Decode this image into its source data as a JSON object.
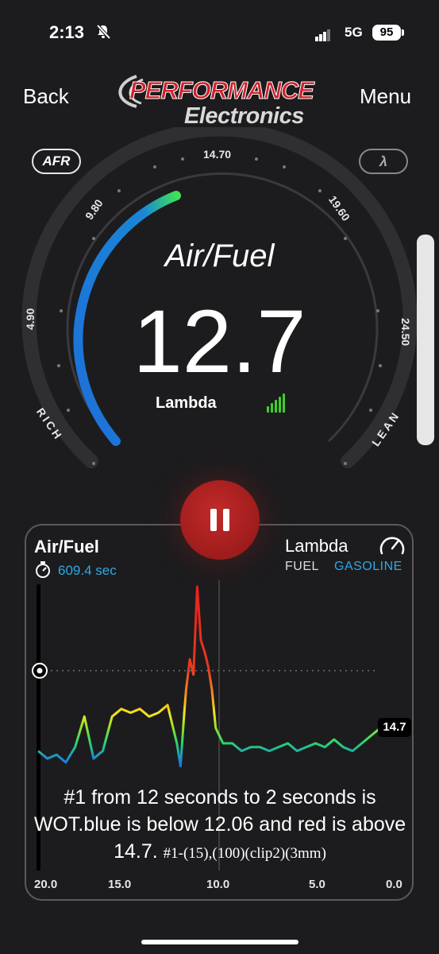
{
  "status": {
    "time": "2:13",
    "network": "5G",
    "battery": "95"
  },
  "header": {
    "back_label": "Back",
    "menu_label": "Menu",
    "logo_line1": "PERFORMANCE",
    "logo_line2": "Electronics"
  },
  "gauge": {
    "afr_toggle": "AFR",
    "lambda_toggle": "λ",
    "title": "Air/Fuel",
    "value": "12.7",
    "sublabel": "Lambda",
    "ticks": [
      "4.90",
      "9.80",
      "14.70",
      "19.60",
      "24.50"
    ],
    "rich_label": "RICH",
    "lean_label": "LEAN",
    "level_fraction": 0.36
  },
  "chart": {
    "title": "Air/Fuel",
    "elapsed": "609.4 sec",
    "lambda_label": "Lambda",
    "fuel_label": "FUEL",
    "fuel_value": "GASOLINE",
    "ref_value": "14.7",
    "xticks": [
      "20.0",
      "15.0",
      "10.0",
      "5.0",
      "0.0"
    ],
    "overlay_main": "#1 from 12 seconds to 2 seconds is WOT.blue is below 12.06 and red is above 14.7.",
    "overlay_small": "#1-(15),(100)(clip2)(3mm)"
  },
  "colors": {
    "accent_blue": "#1e6fd9",
    "accent_green": "#3ecf2e",
    "pause_red": "#a81e1e",
    "label_blue": "#2ea8e6"
  },
  "icons": {
    "mute": "bell-slash-icon",
    "timer": "stopwatch-icon",
    "gauge": "speedometer-icon",
    "pause": "pause-icon"
  },
  "chart_data": {
    "type": "line",
    "x": [
      20.0,
      19.5,
      19.0,
      18.5,
      18.0,
      17.5,
      17.0,
      16.5,
      16.0,
      15.5,
      15.0,
      14.5,
      14.0,
      13.5,
      13.0,
      12.5,
      12.3,
      12.1,
      12.0,
      11.8,
      11.6,
      11.4,
      11.2,
      11.0,
      10.8,
      10.6,
      10.4,
      10.2,
      10.0,
      9.5,
      9.0,
      8.5,
      8.0,
      7.5,
      7.0,
      6.5,
      6.0,
      5.5,
      5.0,
      4.5,
      4.0,
      3.5,
      3.0,
      2.5,
      2.0,
      1.5,
      1.0,
      0.5,
      0.0
    ],
    "y": [
      12.6,
      12.4,
      12.5,
      12.3,
      12.7,
      13.5,
      12.4,
      12.6,
      13.5,
      13.7,
      13.6,
      13.7,
      13.5,
      13.6,
      13.8,
      12.8,
      12.2,
      13.6,
      14.2,
      15.0,
      14.6,
      16.9,
      15.5,
      15.2,
      14.8,
      14.2,
      13.2,
      13.0,
      12.8,
      12.8,
      12.6,
      12.7,
      12.7,
      12.6,
      12.7,
      12.8,
      12.6,
      12.7,
      12.8,
      12.7,
      12.9,
      12.7,
      12.6,
      12.8,
      13.0,
      13.2,
      13.1,
      13.0,
      13.1
    ],
    "xlabel": "",
    "ylabel": "",
    "xlim": [
      20.0,
      0.0
    ],
    "reference_line": 14.7,
    "grid": false
  }
}
